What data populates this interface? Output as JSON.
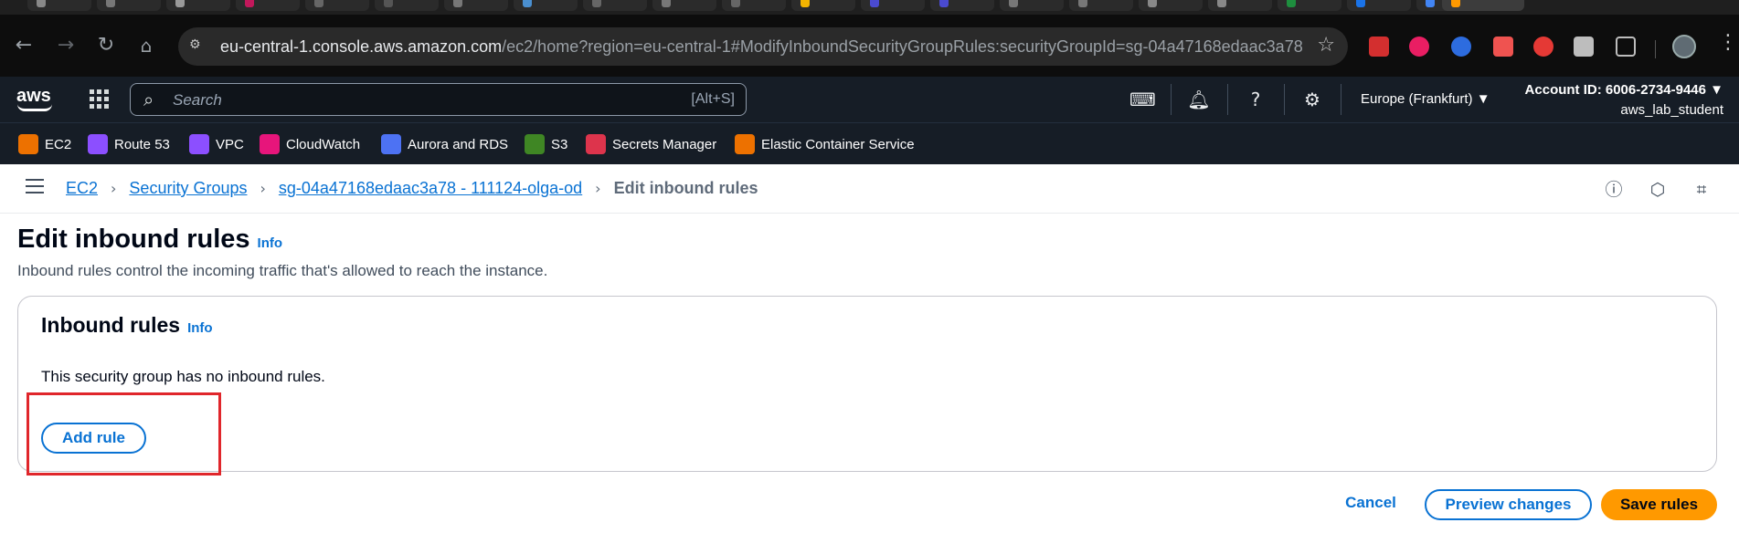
{
  "browser": {
    "url_host": "eu-central-1.console.aws.amazon.com",
    "url_path": "/ec2/home?region=eu-central-1#ModifyInboundSecurityGroupRules:securityGroupId=sg-04a47168edaac3a78",
    "icons": {
      "back": "arrow-left-icon",
      "forward": "arrow-right-icon",
      "reload": "reload-icon",
      "home": "home-icon",
      "bookmark": "star-icon"
    }
  },
  "aws_header": {
    "logo": "aws",
    "search_placeholder": "Search",
    "search_shortcut": "[Alt+S]",
    "region": "Europe (Frankfurt) ▼",
    "account_id": "Account ID: 6006-2734-9446 ▼",
    "user": "aws_lab_student"
  },
  "favorites": [
    {
      "label": "EC2",
      "color": "#ed7100"
    },
    {
      "label": "Route 53",
      "color": "#8c4fff"
    },
    {
      "label": "VPC",
      "color": "#8c4fff"
    },
    {
      "label": "CloudWatch",
      "color": "#e7157b"
    },
    {
      "label": "Aurora and RDS",
      "color": "#4d72f3"
    },
    {
      "label": "S3",
      "color": "#3f8624"
    },
    {
      "label": "Secrets Manager",
      "color": "#dd344c"
    },
    {
      "label": "Elastic Container Service",
      "color": "#ed7100"
    }
  ],
  "breadcrumb": {
    "ec2": "EC2",
    "security_groups": "Security Groups",
    "group": "sg-04a47168edaac3a78 - 111124-olga-od",
    "current": "Edit inbound rules"
  },
  "page": {
    "title": "Edit inbound rules",
    "info": "Info",
    "description": "Inbound rules control the incoming traffic that's allowed to reach the instance."
  },
  "panel": {
    "title": "Inbound rules",
    "info": "Info",
    "empty_message": "This security group has no inbound rules.",
    "add_rule": "Add rule"
  },
  "actions": {
    "cancel": "Cancel",
    "preview": "Preview changes",
    "save": "Save rules"
  },
  "colors": {
    "aws_navy": "#161d26",
    "link_blue": "#0972d3",
    "primary_orange": "#ff9900",
    "highlight_red": "#e0262b"
  }
}
